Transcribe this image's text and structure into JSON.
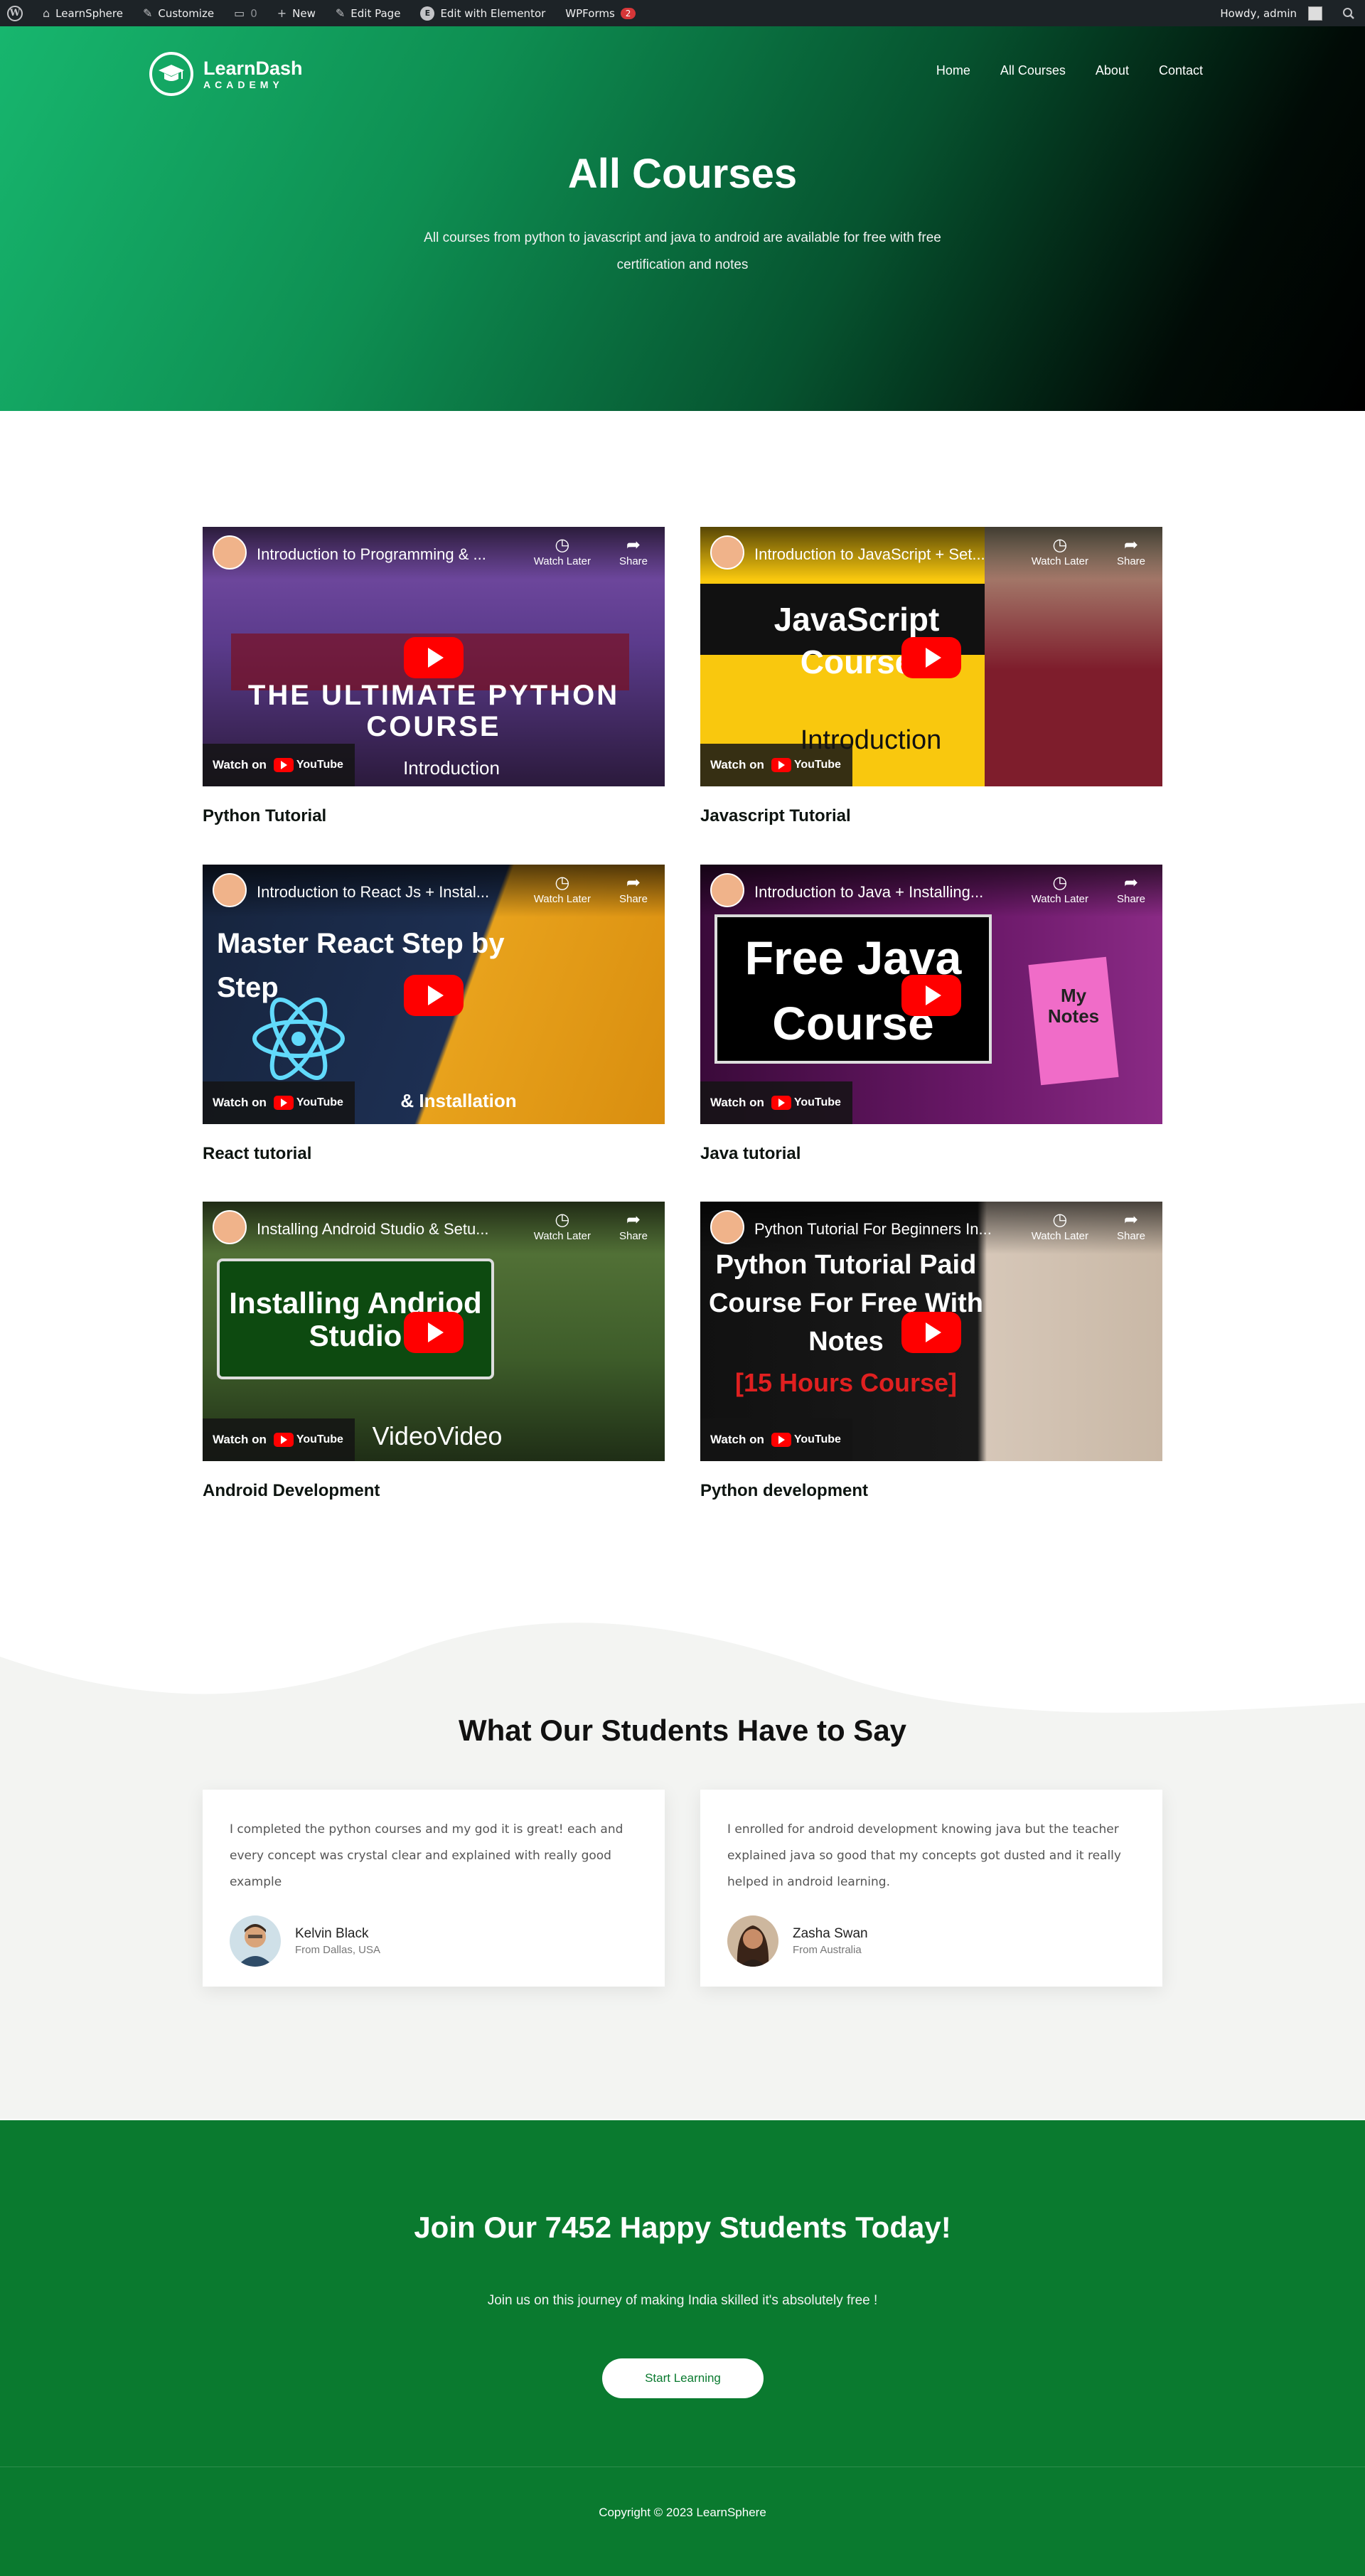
{
  "admin_bar": {
    "site_name": "LearnSphere",
    "customize": "Customize",
    "comments_count": "0",
    "new": "New",
    "edit_page": "Edit Page",
    "edit_elementor": "Edit with Elementor",
    "wpforms": "WPForms",
    "wpforms_badge": "2",
    "howdy": "Howdy, admin"
  },
  "header": {
    "logo_line1": "LearnDash",
    "logo_line2": "ACADEMY",
    "nav": [
      "Home",
      "All Courses",
      "About",
      "Contact"
    ]
  },
  "hero": {
    "title": "All Courses",
    "subtitle": "All courses from python to javascript and java to android are available for free with free certification and notes"
  },
  "video_ui": {
    "watch_later": "Watch Later",
    "share": "Share",
    "watch_on": "Watch on",
    "youtube": "YouTube"
  },
  "courses": [
    {
      "title": "Python Tutorial",
      "video_title": "Introduction to Programming & ...",
      "overlay": "THE ULTIMATE PYTHON COURSE",
      "sub_overlay": "Introduction"
    },
    {
      "title": "Javascript Tutorial",
      "video_title": "Introduction to JavaScript + Set...",
      "overlay": "JavaScript Course",
      "sub_overlay": "Introduction"
    },
    {
      "title": "React tutorial",
      "video_title": "Introduction to React Js + Instal...",
      "overlay": "Master React Step by Step",
      "sub_overlay": "& Installation"
    },
    {
      "title": "Java tutorial",
      "video_title": "Introduction to Java + Installing...",
      "overlay": "Free Java Course",
      "sub_overlay": "My Notes"
    },
    {
      "title": "Android Development",
      "video_title": "Installing Android Studio & Setu...",
      "overlay": "Installing Andriod Studio",
      "sub_overlay": "VideoVideo"
    },
    {
      "title": "Python development",
      "video_title": "Python Tutorial For Beginners In...",
      "overlay": "Python Tutorial Paid Course For Free With Notes",
      "sub_overlay": "[15 Hours Course]"
    }
  ],
  "testimonials": {
    "heading": "What Our Students Have to Say",
    "items": [
      {
        "quote": "I completed the python courses and my god it is great! each and every concept was crystal clear and explained with really good example",
        "name": "Kelvin Black",
        "location": "From Dallas, USA"
      },
      {
        "quote": "I enrolled for android development knowing java but the teacher explained java so good that my concepts got dusted and it really helped in android learning.",
        "name": "Zasha Swan",
        "location": "From Australia"
      }
    ]
  },
  "cta": {
    "heading": "Join Our 7452 Happy Students Today!",
    "text": "Join us on this journey of making India skilled it's absolutely free !",
    "button": "Start Learning"
  },
  "footer": {
    "copyright": "Copyright © 2023 LearnSphere"
  },
  "colors": {
    "hero_start": "#17b66e",
    "hero_end": "#000000",
    "cta_green": "#0a7a2f",
    "admin_bar": "#1d2327",
    "youtube_red": "#ff0000"
  }
}
